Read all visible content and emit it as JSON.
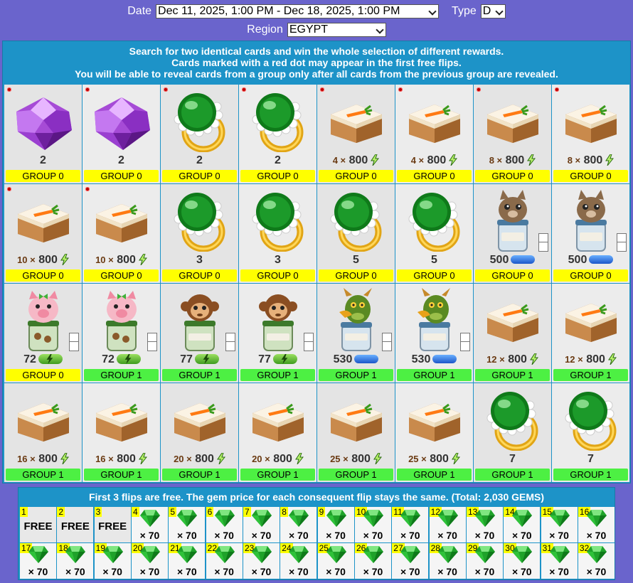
{
  "filters": {
    "date_label": "Date",
    "date_value": "Dec 11, 2025, 1:00 PM - Dec 18, 2025, 1:00 PM",
    "type_label": "Type",
    "type_value": "D",
    "region_label": "Region",
    "region_value": "EGYPT"
  },
  "intro": [
    "Search for two identical cards and win the whole selection of different rewards.",
    "Cards marked with a red dot may appear in the first free flips.",
    "You will be able to reveal cards from a group only after all cards from the previous group are revealed."
  ],
  "cards": [
    {
      "item": "gem-crystal",
      "amount": "2",
      "group": "GROUP 0",
      "g": 0,
      "dot": true
    },
    {
      "item": "gem-crystal",
      "amount": "2",
      "group": "GROUP 0",
      "g": 0,
      "dot": true
    },
    {
      "item": "emerald-ring",
      "amount": "2",
      "group": "GROUP 0",
      "g": 0,
      "dot": true
    },
    {
      "item": "emerald-ring",
      "amount": "2",
      "group": "GROUP 0",
      "g": 0,
      "dot": true
    },
    {
      "item": "carrot-cake",
      "mult": "4 ×",
      "amount": "800",
      "suffix": "energy",
      "group": "GROUP 0",
      "g": 0,
      "dot": true
    },
    {
      "item": "carrot-cake",
      "mult": "4 ×",
      "amount": "800",
      "suffix": "energy",
      "group": "GROUP 0",
      "g": 0,
      "dot": true
    },
    {
      "item": "carrot-cake",
      "mult": "8 ×",
      "amount": "800",
      "suffix": "energy",
      "group": "GROUP 0",
      "g": 0,
      "dot": true
    },
    {
      "item": "carrot-cake",
      "mult": "8 ×",
      "amount": "800",
      "suffix": "energy",
      "group": "GROUP 0",
      "g": 0,
      "dot": true
    },
    {
      "item": "carrot-cake",
      "mult": "10 ×",
      "amount": "800",
      "suffix": "energy",
      "group": "GROUP 0",
      "g": 0,
      "dot": true
    },
    {
      "item": "carrot-cake",
      "mult": "10 ×",
      "amount": "800",
      "suffix": "energy",
      "group": "GROUP 0",
      "g": 0,
      "dot": true
    },
    {
      "item": "emerald-ring",
      "amount": "3",
      "group": "GROUP 0",
      "g": 0
    },
    {
      "item": "emerald-ring",
      "amount": "3",
      "group": "GROUP 0",
      "g": 0
    },
    {
      "item": "emerald-ring",
      "amount": "5",
      "group": "GROUP 0",
      "g": 0
    },
    {
      "item": "emerald-ring",
      "amount": "5",
      "group": "GROUP 0",
      "g": 0
    },
    {
      "item": "cat-cookie-jar",
      "amount": "500",
      "suffix": "blue-pill",
      "group": "GROUP 0",
      "g": 0,
      "box": true
    },
    {
      "item": "cat-cookie-jar",
      "amount": "500",
      "suffix": "blue-pill",
      "group": "GROUP 0",
      "g": 0,
      "box": true
    },
    {
      "item": "pig-cookie-jar",
      "amount": "72",
      "suffix": "green-pill",
      "group": "GROUP 0",
      "g": 0,
      "box": true
    },
    {
      "item": "pig-cookie-jar",
      "amount": "72",
      "suffix": "green-pill",
      "group": "GROUP 1",
      "g": 1,
      "box": true
    },
    {
      "item": "monkey-cookie-jar",
      "amount": "77",
      "suffix": "green-pill",
      "group": "GROUP 1",
      "g": 1,
      "box": true
    },
    {
      "item": "monkey-cookie-jar",
      "amount": "77",
      "suffix": "green-pill",
      "group": "GROUP 1",
      "g": 1,
      "box": true
    },
    {
      "item": "dragon-cookie-jar",
      "amount": "530",
      "suffix": "blue-pill",
      "group": "GROUP 1",
      "g": 1,
      "box": true
    },
    {
      "item": "dragon-cookie-jar",
      "amount": "530",
      "suffix": "blue-pill",
      "group": "GROUP 1",
      "g": 1,
      "box": true
    },
    {
      "item": "carrot-cake",
      "mult": "12 ×",
      "amount": "800",
      "suffix": "energy",
      "group": "GROUP 1",
      "g": 1
    },
    {
      "item": "carrot-cake",
      "mult": "12 ×",
      "amount": "800",
      "suffix": "energy",
      "group": "GROUP 1",
      "g": 1
    },
    {
      "item": "carrot-cake",
      "mult": "16 ×",
      "amount": "800",
      "suffix": "energy",
      "group": "GROUP 1",
      "g": 1
    },
    {
      "item": "carrot-cake",
      "mult": "16 ×",
      "amount": "800",
      "suffix": "energy",
      "group": "GROUP 1",
      "g": 1
    },
    {
      "item": "carrot-cake",
      "mult": "20 ×",
      "amount": "800",
      "suffix": "energy",
      "group": "GROUP 1",
      "g": 1
    },
    {
      "item": "carrot-cake",
      "mult": "20 ×",
      "amount": "800",
      "suffix": "energy",
      "group": "GROUP 1",
      "g": 1
    },
    {
      "item": "carrot-cake",
      "mult": "25 ×",
      "amount": "800",
      "suffix": "energy",
      "group": "GROUP 1",
      "g": 1
    },
    {
      "item": "carrot-cake",
      "mult": "25 ×",
      "amount": "800",
      "suffix": "energy",
      "group": "GROUP 1",
      "g": 1
    },
    {
      "item": "emerald-ring",
      "amount": "7",
      "group": "GROUP 1",
      "g": 1
    },
    {
      "item": "emerald-ring",
      "amount": "7",
      "group": "GROUP 1",
      "g": 1
    }
  ],
  "flips_title": "First 3 flips are free. The gem price for each consequent flip stays the same. (Total: 2,030 GEMS)",
  "flips": [
    {
      "n": "1",
      "free": "FREE"
    },
    {
      "n": "2",
      "free": "FREE"
    },
    {
      "n": "3",
      "free": "FREE"
    },
    {
      "n": "4",
      "cost": "× 70"
    },
    {
      "n": "5",
      "cost": "× 70"
    },
    {
      "n": "6",
      "cost": "× 70"
    },
    {
      "n": "7",
      "cost": "× 70"
    },
    {
      "n": "8",
      "cost": "× 70"
    },
    {
      "n": "9",
      "cost": "× 70"
    },
    {
      "n": "10",
      "cost": "× 70"
    },
    {
      "n": "11",
      "cost": "× 70"
    },
    {
      "n": "12",
      "cost": "× 70"
    },
    {
      "n": "13",
      "cost": "× 70"
    },
    {
      "n": "14",
      "cost": "× 70"
    },
    {
      "n": "15",
      "cost": "× 70"
    },
    {
      "n": "16",
      "cost": "× 70"
    },
    {
      "n": "17",
      "cost": "× 70"
    },
    {
      "n": "18",
      "cost": "× 70"
    },
    {
      "n": "19",
      "cost": "× 70"
    },
    {
      "n": "20",
      "cost": "× 70"
    },
    {
      "n": "21",
      "cost": "× 70"
    },
    {
      "n": "22",
      "cost": "× 70"
    },
    {
      "n": "23",
      "cost": "× 70"
    },
    {
      "n": "24",
      "cost": "× 70"
    },
    {
      "n": "25",
      "cost": "× 70"
    },
    {
      "n": "26",
      "cost": "× 70"
    },
    {
      "n": "27",
      "cost": "× 70"
    },
    {
      "n": "28",
      "cost": "× 70"
    },
    {
      "n": "29",
      "cost": "× 70"
    },
    {
      "n": "30",
      "cost": "× 70"
    },
    {
      "n": "31",
      "cost": "× 70"
    },
    {
      "n": "32",
      "cost": "× 70"
    }
  ],
  "colors": {
    "background": "#6a64cc",
    "panel": "#1d93c8",
    "group0": "#ffff00",
    "group1": "#4df043",
    "red_dot": "#bb0000"
  }
}
